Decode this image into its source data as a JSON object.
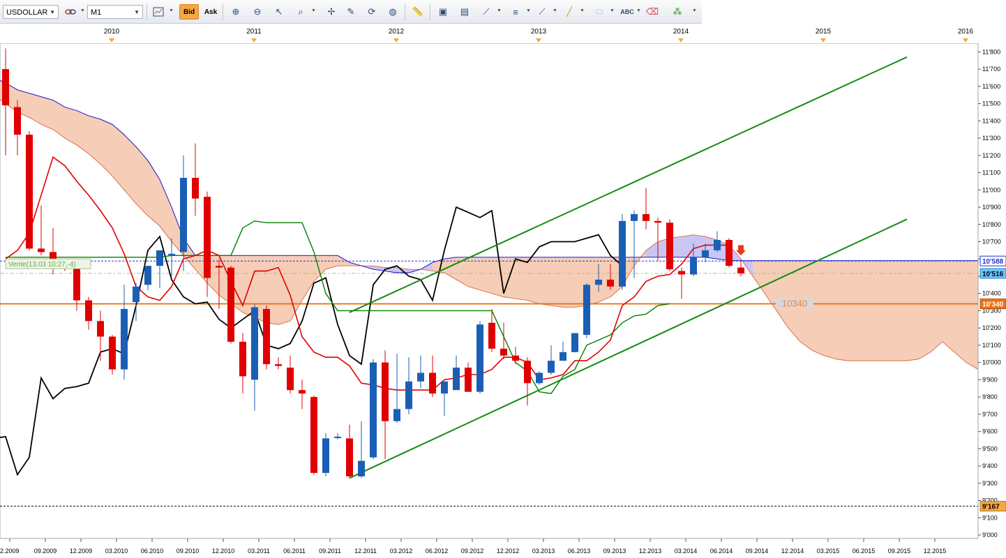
{
  "toolbar": {
    "symbol": "USDOLLAR",
    "timeframe": "M1",
    "bid_label": "Bid",
    "ask_label": "Ask",
    "icons": [
      "chain-icon",
      "zoom-in-icon",
      "zoom-out-icon",
      "cursor-icon",
      "zoom-box-icon",
      "crosshair-icon",
      "chart-edit-icon",
      "refresh-icon",
      "globe-icon",
      "ruler-icon",
      "screenshot-icon",
      "template-icon",
      "indicator-icon",
      "lines-icon",
      "trendline-icon",
      "draw-line-icon",
      "ellipse-icon",
      "text-label-icon",
      "eraser-icon",
      "objects-icon"
    ]
  },
  "year_labels": [
    "2010",
    "2011",
    "2012",
    "2013",
    "2014",
    "2015",
    "2016"
  ],
  "month_labels": [
    "2.2009",
    "09.2009",
    "12.2009",
    "03.2010",
    "06.2010",
    "09.2010",
    "12.2010",
    "03.2011",
    "06.2011",
    "09.2011",
    "12.2011",
    "03.2012",
    "06.2012",
    "09.2012",
    "12.2012",
    "03.2013",
    "06.2013",
    "09.2013",
    "12.2013",
    "03.2014",
    "06.2014",
    "09.2014",
    "12.2014",
    "03.2015",
    "06.2015",
    "09.2015",
    "12.2015"
  ],
  "price_labels": [
    "11'800",
    "11'700",
    "11'600",
    "11'500",
    "11'400",
    "11'300",
    "11'200",
    "11'100",
    "11'000",
    "10'900",
    "10'800",
    "10'700",
    "10'600",
    "10'500",
    "10'400",
    "10'300",
    "10'200",
    "10'100",
    "10'000",
    "9'900",
    "9'800",
    "9'700",
    "9'600",
    "9'500",
    "9'400",
    "9'300",
    "9'200",
    "9'100",
    "9'000"
  ],
  "price_tags": {
    "ask_line": "10'588",
    "bid_line": "10'516",
    "level_line": "10'340",
    "low_line": "9'167"
  },
  "level_label": "10340",
  "order_label": "Vente(13.03 10:27,-4)",
  "colors": {
    "bull": "#1a5fb4",
    "bear": "#e00000",
    "cloud_bear": "#f6cdb6",
    "cloud_bull": "#c9c6f3",
    "tenkan": "#e00000",
    "kijun": "#008000",
    "chikou": "#000000",
    "span_b": "#0000cc",
    "channel": "#138a13",
    "level": "#f07010"
  },
  "chart_data": {
    "type": "candlestick",
    "instrument": "USDOLLAR",
    "timeframe": "M1",
    "candles": [
      {
        "open": 11700,
        "high": 11820,
        "low": 11200,
        "close": 11490
      },
      {
        "open": 11480,
        "high": 11520,
        "low": 11200,
        "close": 11320
      },
      {
        "open": 11320,
        "high": 11340,
        "low": 10650,
        "close": 10660
      },
      {
        "open": 10660,
        "high": 10910,
        "low": 10620,
        "close": 10640
      },
      {
        "open": 10640,
        "high": 10780,
        "low": 10510,
        "close": 10560
      },
      {
        "open": 10560,
        "high": 10580,
        "low": 10530,
        "close": 10550
      },
      {
        "open": 10550,
        "high": 10560,
        "low": 10300,
        "close": 10360
      },
      {
        "open": 10360,
        "high": 10380,
        "low": 10190,
        "close": 10240
      },
      {
        "open": 10240,
        "high": 10300,
        "low": 10010,
        "close": 10150
      },
      {
        "open": 10150,
        "high": 10160,
        "low": 9930,
        "close": 9960
      },
      {
        "open": 9960,
        "high": 10450,
        "low": 9900,
        "close": 10310
      },
      {
        "open": 10350,
        "high": 10460,
        "low": 10240,
        "close": 10440
      },
      {
        "open": 10450,
        "high": 10560,
        "low": 10420,
        "close": 10560
      },
      {
        "open": 10560,
        "high": 10640,
        "low": 10430,
        "close": 10650
      },
      {
        "open": 10630,
        "high": 10720,
        "low": 10500,
        "close": 10630
      },
      {
        "open": 10640,
        "high": 11200,
        "low": 10530,
        "close": 11070
      },
      {
        "open": 11070,
        "high": 11270,
        "low": 10850,
        "close": 10950
      },
      {
        "open": 10960,
        "high": 10990,
        "low": 10380,
        "close": 10490
      },
      {
        "open": 10560,
        "high": 10600,
        "low": 10310,
        "close": 10550
      },
      {
        "open": 10550,
        "high": 10560,
        "low": 10110,
        "close": 10120
      },
      {
        "open": 10120,
        "high": 10170,
        "low": 9820,
        "close": 9920
      },
      {
        "open": 9900,
        "high": 10340,
        "low": 9720,
        "close": 10320
      },
      {
        "open": 10310,
        "high": 10330,
        "low": 9960,
        "close": 9990
      },
      {
        "open": 9990,
        "high": 10030,
        "low": 9960,
        "close": 9980
      },
      {
        "open": 9970,
        "high": 10040,
        "low": 9820,
        "close": 9840
      },
      {
        "open": 9840,
        "high": 9900,
        "low": 9730,
        "close": 9820
      },
      {
        "open": 9800,
        "high": 9810,
        "low": 9350,
        "close": 9360
      },
      {
        "open": 9360,
        "high": 9590,
        "low": 9340,
        "close": 9560
      },
      {
        "open": 9565,
        "high": 9590,
        "low": 9555,
        "close": 9570
      },
      {
        "open": 9560,
        "high": 9640,
        "low": 9330,
        "close": 9340
      },
      {
        "open": 9340,
        "high": 9660,
        "low": 9330,
        "close": 9430
      },
      {
        "open": 9450,
        "high": 10020,
        "low": 9440,
        "close": 10000
      },
      {
        "open": 10000,
        "high": 10070,
        "low": 9440,
        "close": 9660
      },
      {
        "open": 9660,
        "high": 10050,
        "low": 9650,
        "close": 9730
      },
      {
        "open": 9730,
        "high": 10030,
        "low": 9700,
        "close": 9890
      },
      {
        "open": 9890,
        "high": 10040,
        "low": 9850,
        "close": 9940
      },
      {
        "open": 9940,
        "high": 10040,
        "low": 9800,
        "close": 9820
      },
      {
        "open": 9820,
        "high": 9880,
        "low": 9690,
        "close": 9890
      },
      {
        "open": 9840,
        "high": 10040,
        "low": 9850,
        "close": 9970
      },
      {
        "open": 9970,
        "high": 10000,
        "low": 9830,
        "close": 9830
      },
      {
        "open": 9830,
        "high": 10240,
        "low": 9820,
        "close": 10220
      },
      {
        "open": 10230,
        "high": 10310,
        "low": 10060,
        "close": 10080
      },
      {
        "open": 10080,
        "high": 10230,
        "low": 10020,
        "close": 10040
      },
      {
        "open": 10040,
        "high": 10090,
        "low": 9990,
        "close": 10010
      },
      {
        "open": 10010,
        "high": 10030,
        "low": 9750,
        "close": 9880
      },
      {
        "open": 9880,
        "high": 9950,
        "low": 9870,
        "close": 9940
      },
      {
        "open": 9940,
        "high": 10100,
        "low": 9930,
        "close": 10010
      },
      {
        "open": 10010,
        "high": 10120,
        "low": 10010,
        "close": 10060
      },
      {
        "open": 10060,
        "high": 10170,
        "low": 10060,
        "close": 10170
      },
      {
        "open": 10160,
        "high": 10460,
        "low": 10140,
        "close": 10450
      },
      {
        "open": 10450,
        "high": 10570,
        "low": 10410,
        "close": 10480
      },
      {
        "open": 10480,
        "high": 10570,
        "low": 10420,
        "close": 10440
      },
      {
        "open": 10440,
        "high": 10860,
        "low": 10420,
        "close": 10820
      },
      {
        "open": 10820,
        "high": 10880,
        "low": 10490,
        "close": 10860
      },
      {
        "open": 10860,
        "high": 11010,
        "low": 10770,
        "close": 10820
      },
      {
        "open": 10820,
        "high": 10840,
        "low": 10590,
        "close": 10810
      },
      {
        "open": 10810,
        "high": 10830,
        "low": 10530,
        "close": 10540
      },
      {
        "open": 10530,
        "high": 10550,
        "low": 10370,
        "close": 10510
      },
      {
        "open": 10510,
        "high": 10690,
        "low": 10500,
        "close": 10610
      },
      {
        "open": 10610,
        "high": 10690,
        "low": 10580,
        "close": 10650
      },
      {
        "open": 10650,
        "high": 10760,
        "low": 10640,
        "close": 10710
      },
      {
        "open": 10710,
        "high": 10720,
        "low": 10550,
        "close": 10560
      },
      {
        "open": 10550,
        "high": 10590,
        "low": 10500,
        "close": 10516
      }
    ],
    "ichimoku": {
      "tenkan": [
        10600,
        10650,
        10750,
        10970,
        11190,
        11140,
        11050,
        10970,
        10880,
        10780,
        10630,
        10440,
        10380,
        10360,
        10440,
        10600,
        10620,
        10650,
        10620,
        10470,
        10330,
        10530,
        10530,
        10550,
        10390,
        10150,
        10060,
        10030,
        10030,
        9980,
        9880,
        9870,
        9850,
        9840,
        9840,
        9840,
        9840,
        9900,
        9910,
        9930,
        9930,
        9960,
        10030,
        10030,
        10000,
        9900,
        9910,
        9930,
        10010,
        10010,
        10060,
        10130,
        10330,
        10380,
        10470,
        10500,
        10510,
        10570,
        10660,
        10680,
        10680,
        10680
      ],
      "kijun": [
        10610,
        10610,
        10610,
        10610,
        10610,
        10610,
        10610,
        10610,
        10610,
        10610,
        10610,
        10610,
        10610,
        10610,
        10620,
        10620,
        10620,
        10620,
        10620,
        10620,
        10780,
        10820,
        10810,
        10810,
        10810,
        10810,
        10640,
        10400,
        10300,
        10300,
        10300,
        10300,
        10300,
        10300,
        10300,
        10300,
        10300,
        10300,
        10300,
        10300,
        10300,
        10300,
        10150,
        10000,
        9950,
        9830,
        9820,
        9920,
        9960,
        10100,
        10130,
        10160,
        10230,
        10270,
        10280,
        10330,
        10340
      ]
    },
    "channel": {
      "lower": [
        {
          "date": "09.2011",
          "y": 9330
        },
        {
          "date": "11.2015",
          "y": 10830
        }
      ],
      "upper": [
        {
          "date": "09.2011",
          "y": 10290
        },
        {
          "date": "11.2015",
          "y": 11770
        }
      ]
    },
    "levels": {
      "ask": 10588,
      "bid": 10516,
      "horizontal": 10340,
      "low": 9167
    },
    "ylim": [
      8980,
      11850
    ]
  }
}
